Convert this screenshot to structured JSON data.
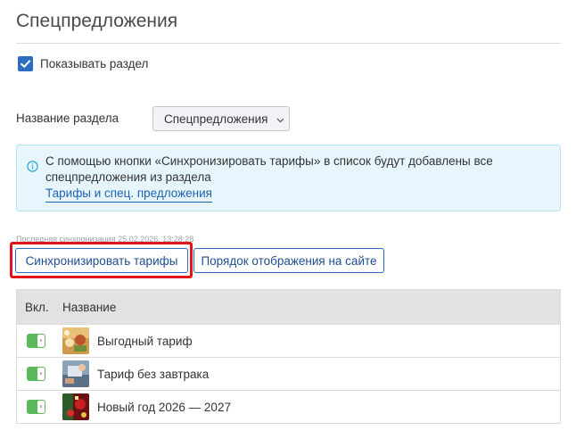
{
  "page": {
    "title": "Спецпредложения"
  },
  "show_section": {
    "label": "Показывать раздел",
    "checked": true
  },
  "section_name": {
    "label": "Название раздела",
    "value": "Спецпредложения"
  },
  "info": {
    "text": "С помощью кнопки «Синхронизировать тарифы» в список будут добавлены все спецпредложения из раздела",
    "link": "Тарифы и спец. предложения"
  },
  "last_sync": "Последняя синхронизация 25.02.2026, 13:28:28",
  "buttons": {
    "sync": "Синхронизировать тарифы",
    "order": "Порядок отображения на сайте"
  },
  "table": {
    "headers": {
      "enabled": "Вкл.",
      "name": "Название"
    },
    "rows": [
      {
        "name": "Выгодный тариф",
        "enabled": true
      },
      {
        "name": "Тариф без завтрака",
        "enabled": true
      },
      {
        "name": "Новый год 2026 — 2027",
        "enabled": true
      }
    ]
  },
  "colors": {
    "accent": "#2d6dbf",
    "toggle_on": "#5cb85c",
    "highlight": "#e0151a"
  }
}
